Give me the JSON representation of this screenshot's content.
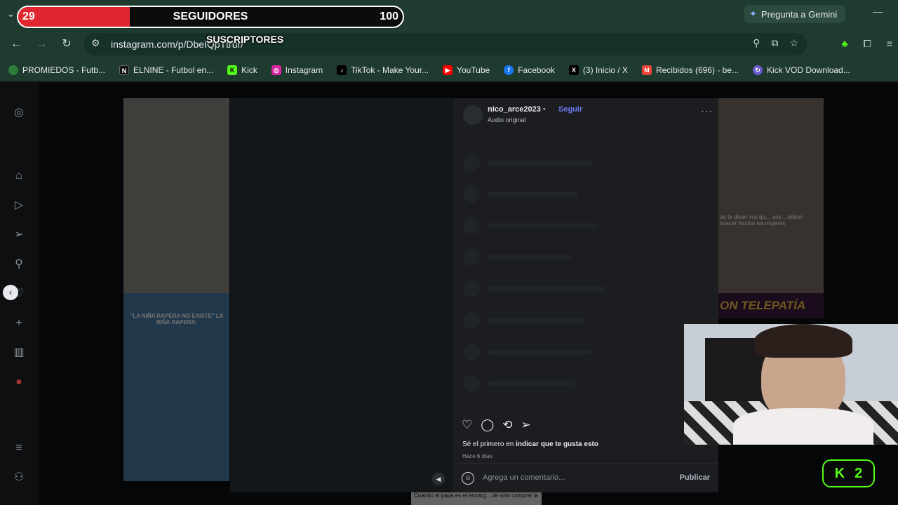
{
  "browser": {
    "gemini_label": "Pregunta a Gemini",
    "url": "instagram.com/p/DbeIQpTtrur/"
  },
  "bookmarks": [
    {
      "label": "PROMIEDOS - Futb...",
      "icon": "promiedos-icon",
      "color": "#2d7d3a"
    },
    {
      "label": "ELNINE - Futbol en...",
      "icon": "elnine-icon",
      "color": "#111111"
    },
    {
      "label": "Kick",
      "icon": "kick-icon",
      "color": "#53fc18"
    },
    {
      "label": "Instagram",
      "icon": "instagram-icon",
      "color": "#d6249f"
    },
    {
      "label": "TikTok - Make Your...",
      "icon": "tiktok-icon",
      "color": "#000000"
    },
    {
      "label": "YouTube",
      "icon": "youtube-icon",
      "color": "#ff0000"
    },
    {
      "label": "Facebook",
      "icon": "facebook-icon",
      "color": "#1877f2"
    },
    {
      "label": "(3) Inicio / X",
      "icon": "x-icon",
      "color": "#000000"
    },
    {
      "label": "Recibidos (696) - be...",
      "icon": "gmail-icon",
      "color": "#ea4335"
    },
    {
      "label": "Kick VOD Download...",
      "icon": "kick-vod-icon",
      "color": "#6a5acd"
    }
  ],
  "post": {
    "username": "nico_arce2023",
    "separator": "•",
    "follow_label": "Seguir",
    "audio": "Audio original",
    "likes_prefix": "Sé el primero en ",
    "likes_action": "indicar que te gusta esto",
    "time": "Hace 6 días",
    "comment_placeholder": "Agrega un comentario...",
    "publish_label": "Publicar"
  },
  "grid_captions": {
    "tile_right_1": "do te dicen vos qu… sos ...deben buscar mucho las mujeres",
    "tile_right_banner": "ON TELEPATÍA",
    "tile_left_2_header": "\"LA NIÑA RAPERA NO EXISTE\" LA NIÑA RAPERA:",
    "tile_bottom_1": "Cuando el papa es el encarg... de solo comprar la vela"
  },
  "stream_overlay": {
    "sub_current": "29",
    "sub_goal": "100",
    "sub_title": "SEGUIDORES",
    "sub_label": "SUSCRIPTORES",
    "sub_progress": 0.29,
    "kick_count": "2",
    "kick_letter": "K"
  },
  "colors": {
    "browser_frame": "#1f3a2f",
    "page_bg": "#0d0f11",
    "follow_link": "#6e7cf0",
    "sub_fill": "#e0262f",
    "kick_green": "#53fc18"
  }
}
